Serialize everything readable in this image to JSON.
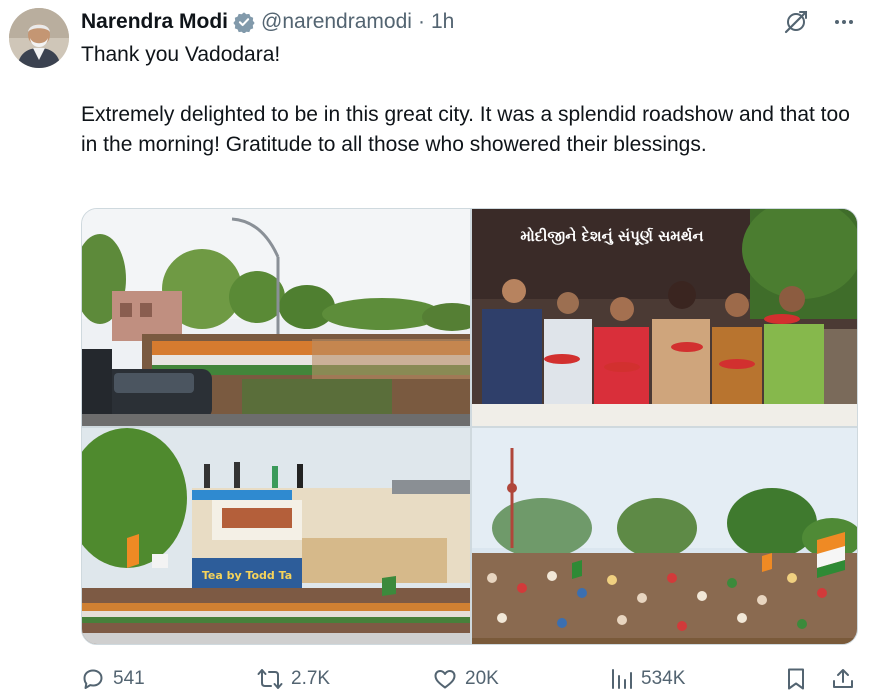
{
  "tweet": {
    "author_name": "Narendra Modi",
    "handle": "@narendramodi",
    "separator": "·",
    "time": "1h",
    "paragraphs": [
      "Thank you Vadodara!",
      "Extremely delighted to be in this great city. It was a splendid roadshow and that too in the morning! Gratitude to all those who showered their blessings."
    ]
  },
  "media": {
    "banner_line1": "મોદીજીને દેશનું સંપૂર્ણ સમર્થન",
    "poster_text": "Tea by Todd Ta"
  },
  "actions": {
    "replies": "541",
    "reposts": "2.7K",
    "likes": "20K",
    "views": "534K"
  },
  "icons": [
    "verified-badge-icon",
    "grok-icon",
    "more-icon",
    "reply-icon",
    "repost-icon",
    "like-icon",
    "views-icon",
    "bookmark-icon",
    "share-icon"
  ],
  "colors": {
    "verified": "#829aab",
    "text": "#0f1419",
    "secondary": "#536471"
  }
}
